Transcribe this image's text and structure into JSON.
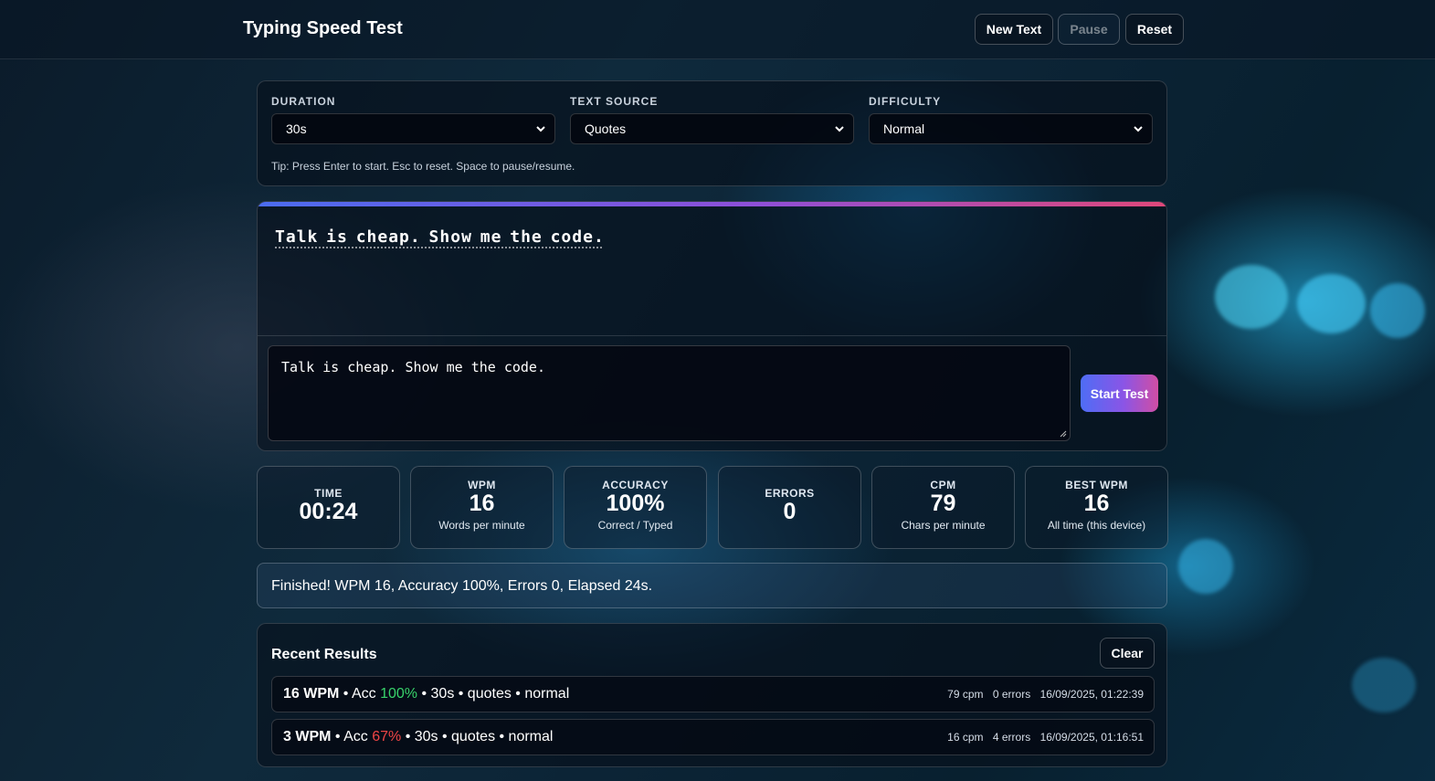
{
  "header": {
    "title": "Typing Speed Test",
    "buttons": {
      "new_text": "New Text",
      "pause": "Pause",
      "reset": "Reset"
    }
  },
  "settings": {
    "duration": {
      "label": "DURATION",
      "value": "30s"
    },
    "text_source": {
      "label": "TEXT SOURCE",
      "value": "Quotes"
    },
    "difficulty": {
      "label": "DIFFICULTY",
      "value": "Normal"
    },
    "tip": "Tip: Press Enter to start. Esc to reset. Space to pause/resume."
  },
  "typing": {
    "target_text": "Talk is cheap. Show me the code.",
    "input_value": "Talk is cheap. Show me the code.",
    "start_button": "Start Test",
    "progress_color_start": "#4b6cf0",
    "progress_color_end": "#e0487a"
  },
  "stats": {
    "time": {
      "label": "TIME",
      "value": "00:24"
    },
    "wpm": {
      "label": "WPM",
      "value": "16",
      "sub": "Words per minute"
    },
    "accuracy": {
      "label": "ACCURACY",
      "value": "100%",
      "sub": "Correct / Typed"
    },
    "errors": {
      "label": "ERRORS",
      "value": "0"
    },
    "cpm": {
      "label": "CPM",
      "value": "79",
      "sub": "Chars per minute"
    },
    "best_wpm": {
      "label": "BEST WPM",
      "value": "16",
      "sub": "All time (this device)"
    }
  },
  "status_message": "Finished! WPM 16, Accuracy 100%, Errors 0, Elapsed 24s.",
  "results": {
    "title": "Recent Results",
    "clear_label": "Clear",
    "rows": [
      {
        "wpm": "16 WPM",
        "acc_prefix": "Acc",
        "acc": "100%",
        "rest": "30s • quotes • normal",
        "cpm": "79 cpm",
        "errors": "0 errors",
        "timestamp": "16/09/2025, 01:22:39"
      },
      {
        "wpm": "3 WPM",
        "acc_prefix": "Acc",
        "acc": "67%",
        "rest": "30s • quotes • normal",
        "cpm": "16 cpm",
        "errors": "4 errors",
        "timestamp": "16/09/2025, 01:16:51"
      }
    ]
  },
  "colors": {
    "accuracy_good": "#38d36b",
    "accuracy_bad": "#ef4545"
  }
}
